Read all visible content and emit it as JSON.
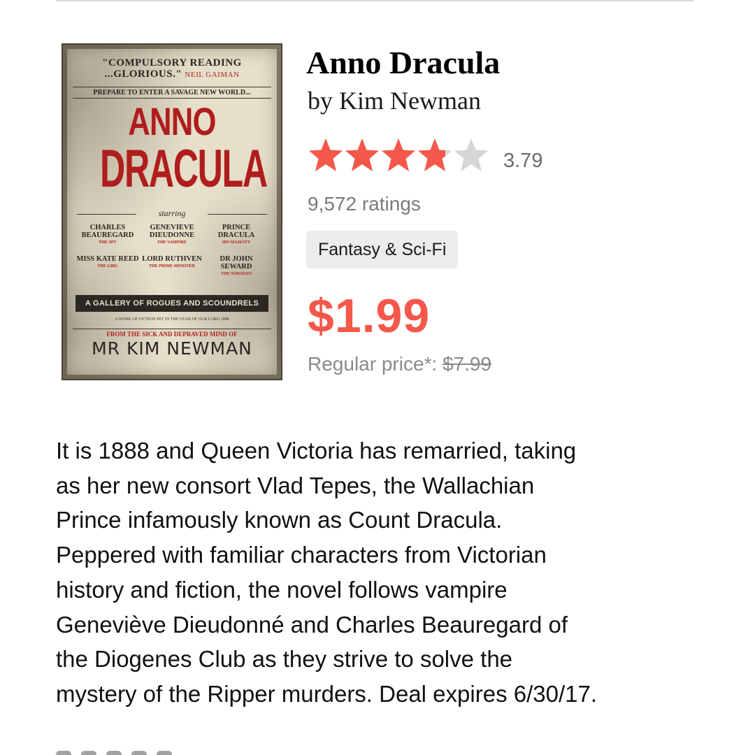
{
  "cover": {
    "quote_line1": "\"COMPULSORY READING",
    "quote_line2": "...GLORIOUS.\"",
    "quote_author": "NEIL GAIMAN",
    "tagline": "PREPARE TO ENTER A SAVAGE NEW WORLD...",
    "title_line1": "ANNO",
    "title_line2": "DRACULA",
    "starring": "starring",
    "cast": [
      {
        "name": "CHARLES BEAUREGARD",
        "role": "THE SPY"
      },
      {
        "name": "GENEVIEVE DIEUDONNE",
        "role": "THE VAMPIRE"
      },
      {
        "name": "PRINCE DRACULA",
        "role": "HIS MAJESTY"
      },
      {
        "name": "MISS KATE REED",
        "role": "THE GIRL"
      },
      {
        "name": "LORD RUTHVEN",
        "role": "THE PRIME MINISTER"
      },
      {
        "name": "DR JOHN SEWARD",
        "role": "THE SURGEON"
      }
    ],
    "gallery": "A GALLERY OF ROGUES AND SCOUNDRELS",
    "work_line": "A WORK OF FICTION SET IN THE YEAR OF OUR LORD 1888",
    "from_line": "FROM THE SICK AND DEPRAVED MIND OF",
    "author": "MR KIM NEWMAN"
  },
  "book": {
    "title": "Anno Dracula",
    "author_line": "by Kim Newman",
    "rating": 3.79,
    "rating_text": "3.79",
    "ratings_count": "9,572 ratings",
    "genre": "Fantasy & Sci-Fi",
    "price": "$1.99",
    "regular_label": "Regular price*:",
    "regular_price": "$7.99"
  },
  "description": {
    "lines": [
      "It is 1888 and Queen Victoria has remarried, taking",
      "as her new consort Vlad Tepes, the Wallachian",
      "Prince infamously known as Count Dracula.",
      "Peppered with familiar characters from Victorian",
      "history and fiction, the novel follows vampire",
      "Geneviève Dieudonné and Charles Beauregard of",
      "the Diogenes Club as they strive to solve the",
      "mystery of the Ripper murders. Deal expires 6/30/17."
    ]
  },
  "colors": {
    "star_filled": "#f4584b",
    "star_empty": "#d6d6d6",
    "price": "#f4584b"
  },
  "icons": {
    "rating": "star-icon"
  }
}
